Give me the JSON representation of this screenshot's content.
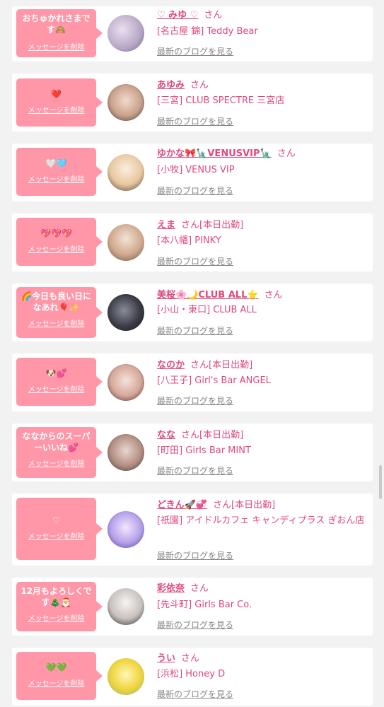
{
  "delete_label": "メッセージを削除",
  "blog_label": "最新のブログを見る",
  "san_label": "さん",
  "entries": [
    {
      "message": "おちゅかれさまです🙈",
      "name": "♡ みゆ ♡",
      "status": "",
      "shop": "[名古屋 錦] Teddy Bear"
    },
    {
      "message": "❤️",
      "name": "あゆみ",
      "status": "",
      "shop": "[三宮] CLUB SPECTRE 三宮店"
    },
    {
      "message": "🤍🩵",
      "name": "ゆかな🎀🗽VENUSVIP🗽",
      "status": "",
      "shop": "[小牧] VENUS VIP"
    },
    {
      "message": "💖💖💖",
      "name": "えま",
      "status": "[本日出勤]",
      "shop": "[本八幡] PINKY"
    },
    {
      "message": "🌈今日も良い日になあれ🎈✨",
      "name": "美桜🌸🌙CLUB ALL⭐",
      "status": "",
      "shop": "[小山・東口] CLUB ALL"
    },
    {
      "message": "🐶💕",
      "name": "なのか",
      "status": "[本日出勤]",
      "shop": "[八王子] Girl's Bar ANGEL"
    },
    {
      "message": "ななからのスーパーいいね💕",
      "name": "なな",
      "status": "[本日出勤]",
      "shop": "[町田] Girls Bar MINT"
    },
    {
      "message": "♡",
      "name": "どきん🚀💞",
      "status": "[本日出勤]",
      "shop": "[祇園] アイドルカフェ キャンディプラス ぎおん店"
    },
    {
      "message": "12月もよろしくです🎄🎅",
      "name": "彩依奈",
      "status": "",
      "shop": "[先斗町] Girls Bar Co."
    },
    {
      "message": "💚💚",
      "name": "うい",
      "status": "",
      "shop": "[浜松] Honey D"
    }
  ]
}
